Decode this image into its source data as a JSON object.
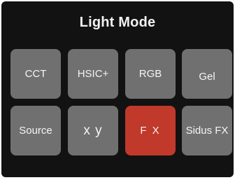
{
  "header": {
    "title": "Light Mode"
  },
  "modes": {
    "cct": "CCT",
    "hsic": "HSIC+",
    "rgb": "RGB",
    "gel": "Gel",
    "source": "Source",
    "xy": "x y",
    "fx": "F X",
    "sidus_fx": "Sidus FX"
  },
  "selected_mode": "F X",
  "colors": {
    "background": "#121212",
    "tile": "#707070",
    "selected_tile": "#c0392b",
    "text": "#f5f5f5"
  }
}
